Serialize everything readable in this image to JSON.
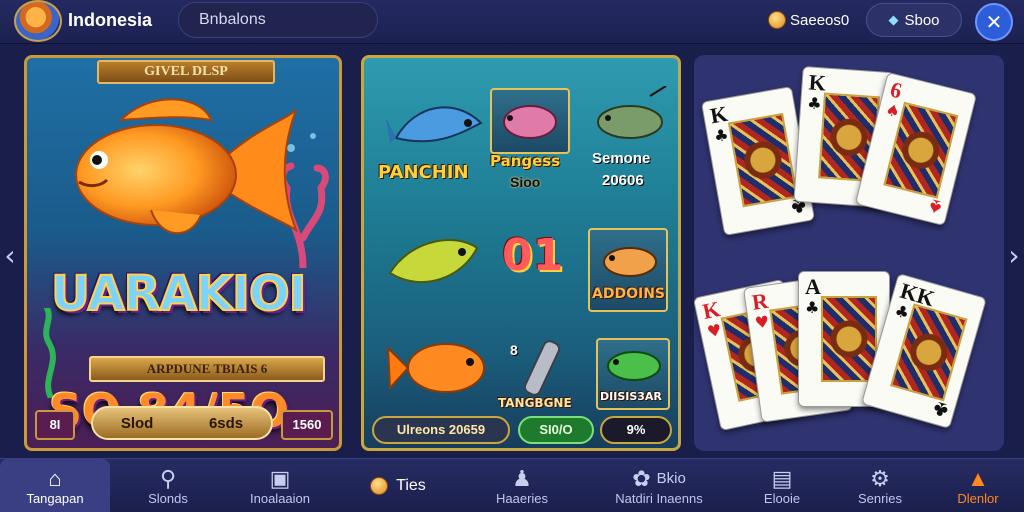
{
  "header": {
    "region": "Indonesia",
    "search_text": "Bnbalons",
    "coins_value": "Saeeos0",
    "balance_label": "Sboo",
    "close_symbol": "✕"
  },
  "nav_arrows": {
    "left": "‹",
    "right": "›"
  },
  "card_fishing_big": {
    "banner": "GIVEL DLSP",
    "title": "UARAKIOI",
    "subtitle": "ARPDUNE TBIAIS 6",
    "number": "SO 84/5O",
    "left_badge": "8I",
    "mid_left": "Slod",
    "mid_right": "6sds",
    "right_badge": "1560"
  },
  "card_fishing_grid": {
    "label_left": "PANCHIN",
    "label_top_mid": "Pangess",
    "sub_top_mid": "Sioo",
    "label_top_right": "Semone",
    "sub_top_right": "20606",
    "center_number": "01",
    "label_mid_right": "ADDOINS",
    "small_mark": "8",
    "label_bottom_mid": "TANGBGNE",
    "label_bottom_right": "DIISIS3AR",
    "bottom_left": "Ulreons 20659",
    "bottom_mid": "SI0/O",
    "bottom_right": "9%"
  },
  "card_cards": {
    "cards": [
      {
        "rank": "K",
        "suit": "♣",
        "color": "black"
      },
      {
        "rank": "K",
        "suit": "♣",
        "color": "black"
      },
      {
        "rank": "6",
        "suit": "♠",
        "color": "red"
      },
      {
        "rank": "K",
        "suit": "♥",
        "color": "red"
      },
      {
        "rank": "R",
        "suit": "♥",
        "color": "red"
      },
      {
        "rank": "A",
        "suit": "♣",
        "color": "black"
      },
      {
        "rank": "KK",
        "suit": "♣",
        "color": "black"
      }
    ]
  },
  "bottom_nav": {
    "items": [
      {
        "label": "Tangapan",
        "icon": "home-icon"
      },
      {
        "label": "Slonds",
        "icon": "search-icon"
      },
      {
        "label": "Inoalaaion",
        "icon": "box-icon"
      },
      {
        "label": "Ties",
        "icon": "coin-icon"
      },
      {
        "label": "Haaeries",
        "icon": "people-icon"
      },
      {
        "label": "Natdiri Inaenns",
        "icon": "gear-icon"
      },
      {
        "label": "Bkio",
        "icon": ""
      },
      {
        "label": "Elooie",
        "icon": "doc-icon"
      },
      {
        "label": "Senries",
        "icon": "cog-icon"
      },
      {
        "label": "Dlenlor",
        "icon": "warning-icon"
      }
    ]
  },
  "colors": {
    "background": "#1a1e4a",
    "accent_gold": "#c99a3c",
    "close_blue": "#2d5ed8",
    "active_orange": "#ff8a1e"
  }
}
